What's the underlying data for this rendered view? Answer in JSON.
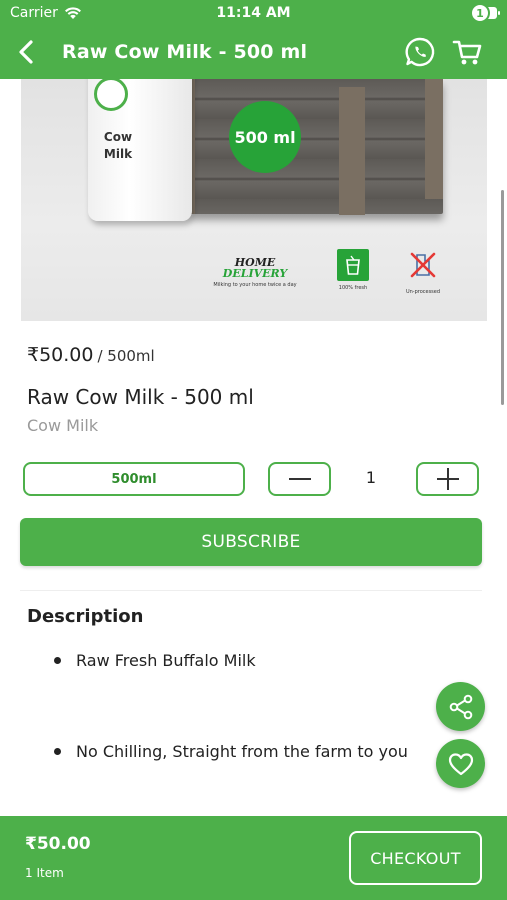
{
  "status_bar": {
    "carrier": "Carrier",
    "time": "11:14 AM"
  },
  "header": {
    "title": "Raw Cow Milk - 500 ml",
    "cart_count": "1",
    "icons": [
      "back-arrow-icon",
      "whatsapp-icon",
      "cart-icon"
    ]
  },
  "hero": {
    "bottle_label": "Cow Milk",
    "size_badge": "500 ml",
    "home_delivery_line1": "HOME",
    "home_delivery_line2": "DELIVERY",
    "home_delivery_caption": "Milking to your home twice a day",
    "fresh_caption": "100% fresh",
    "unprocessed_caption": "Un-processed"
  },
  "product": {
    "price": "₹50.00",
    "unit": "/ 500ml",
    "name": "Raw Cow Milk - 500 ml",
    "category": "Cow Milk"
  },
  "variant": {
    "selected": "500ml"
  },
  "quantity": {
    "value": "1"
  },
  "actions": {
    "subscribe_label": "SUBSCRIBE"
  },
  "description": {
    "title": "Description",
    "items": [
      "Raw Fresh Buffalo Milk",
      "No Chilling, Straight from the farm to you"
    ]
  },
  "fabs": [
    "share-icon",
    "heart-icon"
  ],
  "bottom_bar": {
    "total": "₹50.00",
    "item_count": "1 Item",
    "checkout_label": "CHECKOUT"
  },
  "colors": {
    "brand_green": "#4db04a",
    "badge_green": "#27a338"
  }
}
